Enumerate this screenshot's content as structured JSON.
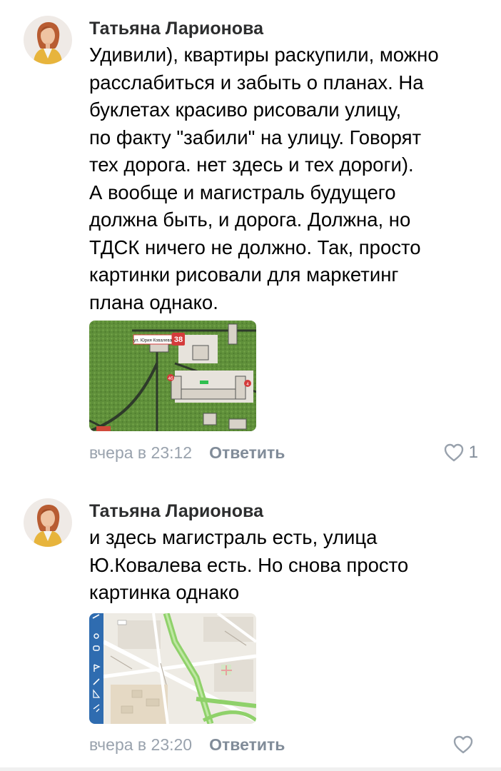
{
  "comments": [
    {
      "author": "Татьяна Ларионова",
      "text": "Удивили), квартиры раскупили, можно\nрасслабиться и забыть о планах. На\nбуклетах красиво рисовали улицу,\nпо факту \"забили\" на улицу. Говорят\nтех дорога. нет здесь и тех дороги).\nА вообще и магистраль будущего\nдолжна быть, и дорога. Должна, но\nТДСК ничего не должно. Так, просто\nкартинки рисовали для маркетинг\nплана однако.",
      "attachment": {
        "street_label": "ул. Юрия Ковалева",
        "house_number": "38",
        "section_1": "4б",
        "section_2": "4"
      },
      "timestamp": "вчера в 23:12",
      "reply_label": "Ответить",
      "like_count": "1"
    },
    {
      "author": "Татьяна Ларионова",
      "text": "и здесь магистраль есть, улица\nЮ.Ковалева есть. Но снова просто\nкартинка однако",
      "timestamp": "вчера в 23:20",
      "reply_label": "Ответить",
      "like_count": ""
    }
  ],
  "colors": {
    "meta": "#99a2ad",
    "reply": "#818c99",
    "author": "#2c2d2e",
    "map_road": "#8fd16a",
    "map_toolbar": "#2f6cb0"
  }
}
